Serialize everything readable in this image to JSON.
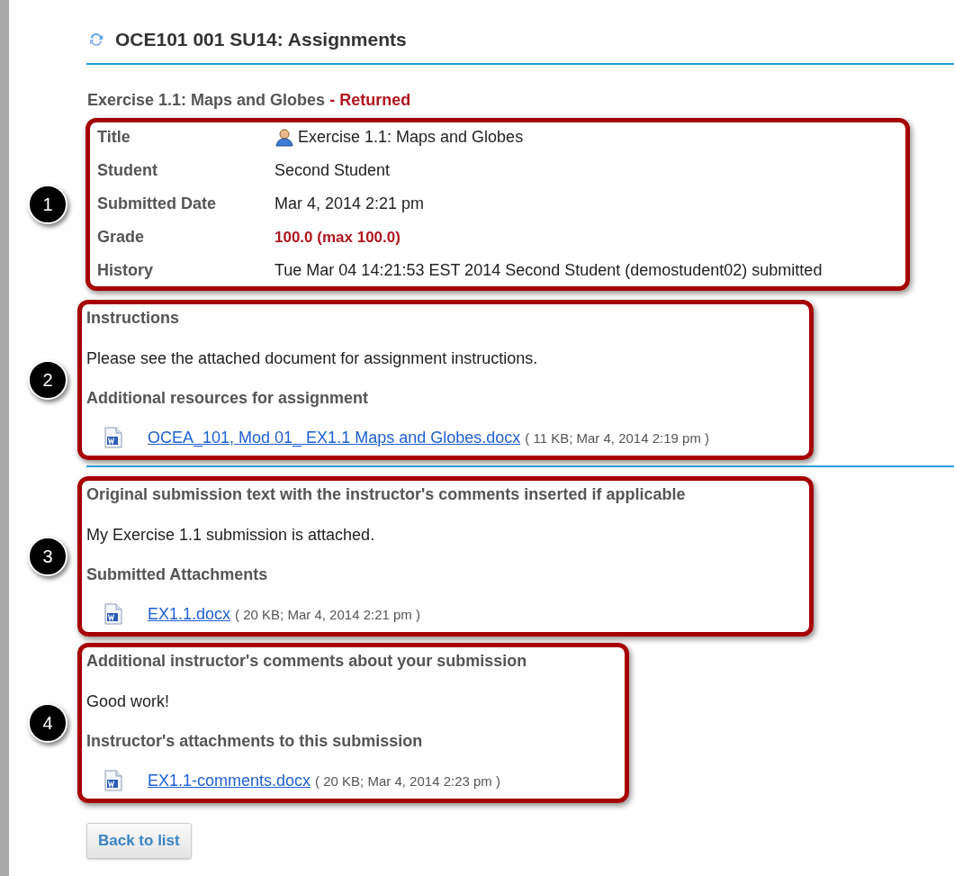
{
  "header": {
    "title": "OCE101 001 SU14: Assignments"
  },
  "assignment": {
    "title": "Exercise 1.1: Maps and Globes",
    "status": "- Returned"
  },
  "details": {
    "callout": "1",
    "rows": [
      {
        "label": "Title",
        "value": "Exercise 1.1: Maps and Globes",
        "kind": "person"
      },
      {
        "label": "Student",
        "value": "Second Student",
        "kind": "plain"
      },
      {
        "label": "Submitted Date",
        "value": "Mar 4, 2014 2:21 pm",
        "kind": "plain"
      },
      {
        "label": "Grade",
        "value": "100.0 (max 100.0)",
        "kind": "grade"
      },
      {
        "label": "History",
        "value": "Tue Mar 04 14:21:53 EST 2014 Second Student (demostudent02) submitted",
        "kind": "plain"
      }
    ]
  },
  "sections": [
    {
      "callout": "2",
      "heading": "Instructions",
      "text": "Please see the attached document for assignment instructions.",
      "subheading": "Additional resources for assignment",
      "attachment": {
        "name": "OCEA_101, Mod 01_ EX1.1 Maps and Globes.docx",
        "info": "( 11 KB; Mar 4, 2014 2:19 pm )"
      },
      "divider_after": true
    },
    {
      "callout": "3",
      "heading": "Original submission text with the instructor's comments inserted if applicable",
      "text": "My Exercise 1.1 submission is attached.",
      "subheading": "Submitted Attachments",
      "attachment": {
        "name": "EX1.1.docx",
        "info": "( 20 KB; Mar 4, 2014 2:21 pm )"
      },
      "divider_after": false
    },
    {
      "callout": "4",
      "heading": "Additional instructor's comments about your submission",
      "text": "Good work!",
      "subheading": "Instructor's attachments to this submission",
      "attachment": {
        "name": "EX1.1-comments.docx",
        "info": "( 20 KB; Mar 4, 2014 2:23 pm )"
      },
      "divider_after": false
    }
  ],
  "back_button": "Back to list"
}
